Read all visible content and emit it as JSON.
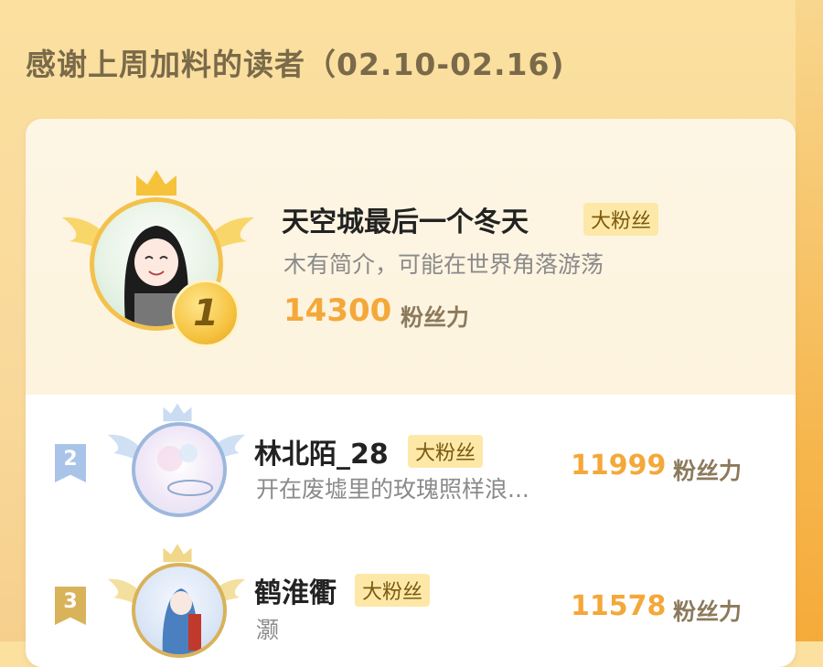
{
  "header": {
    "title": "感谢上周加料的读者（02.10-02.16)"
  },
  "tag_label": "大粉丝",
  "score_unit": "粉丝力",
  "colors": {
    "accent_orange": "#f4a83a",
    "tag_bg": "#fde8a8",
    "rank2": "#a9c4e8",
    "rank3": "#d9b35a"
  },
  "readers": [
    {
      "rank": "1",
      "name": "天空城最后一个冬天",
      "bio": "木有简介，可能在世界角落游荡",
      "score": "14300",
      "icon": "gold-crown-icon"
    },
    {
      "rank": "2",
      "name": "林北陌_28",
      "bio": "开在废墟里的玫瑰照样浪...",
      "score": "11999",
      "icon": "silver-crown-icon"
    },
    {
      "rank": "3",
      "name": "鹤淮衢",
      "bio": "灏",
      "score": "11578",
      "icon": "bronze-crown-icon"
    }
  ]
}
